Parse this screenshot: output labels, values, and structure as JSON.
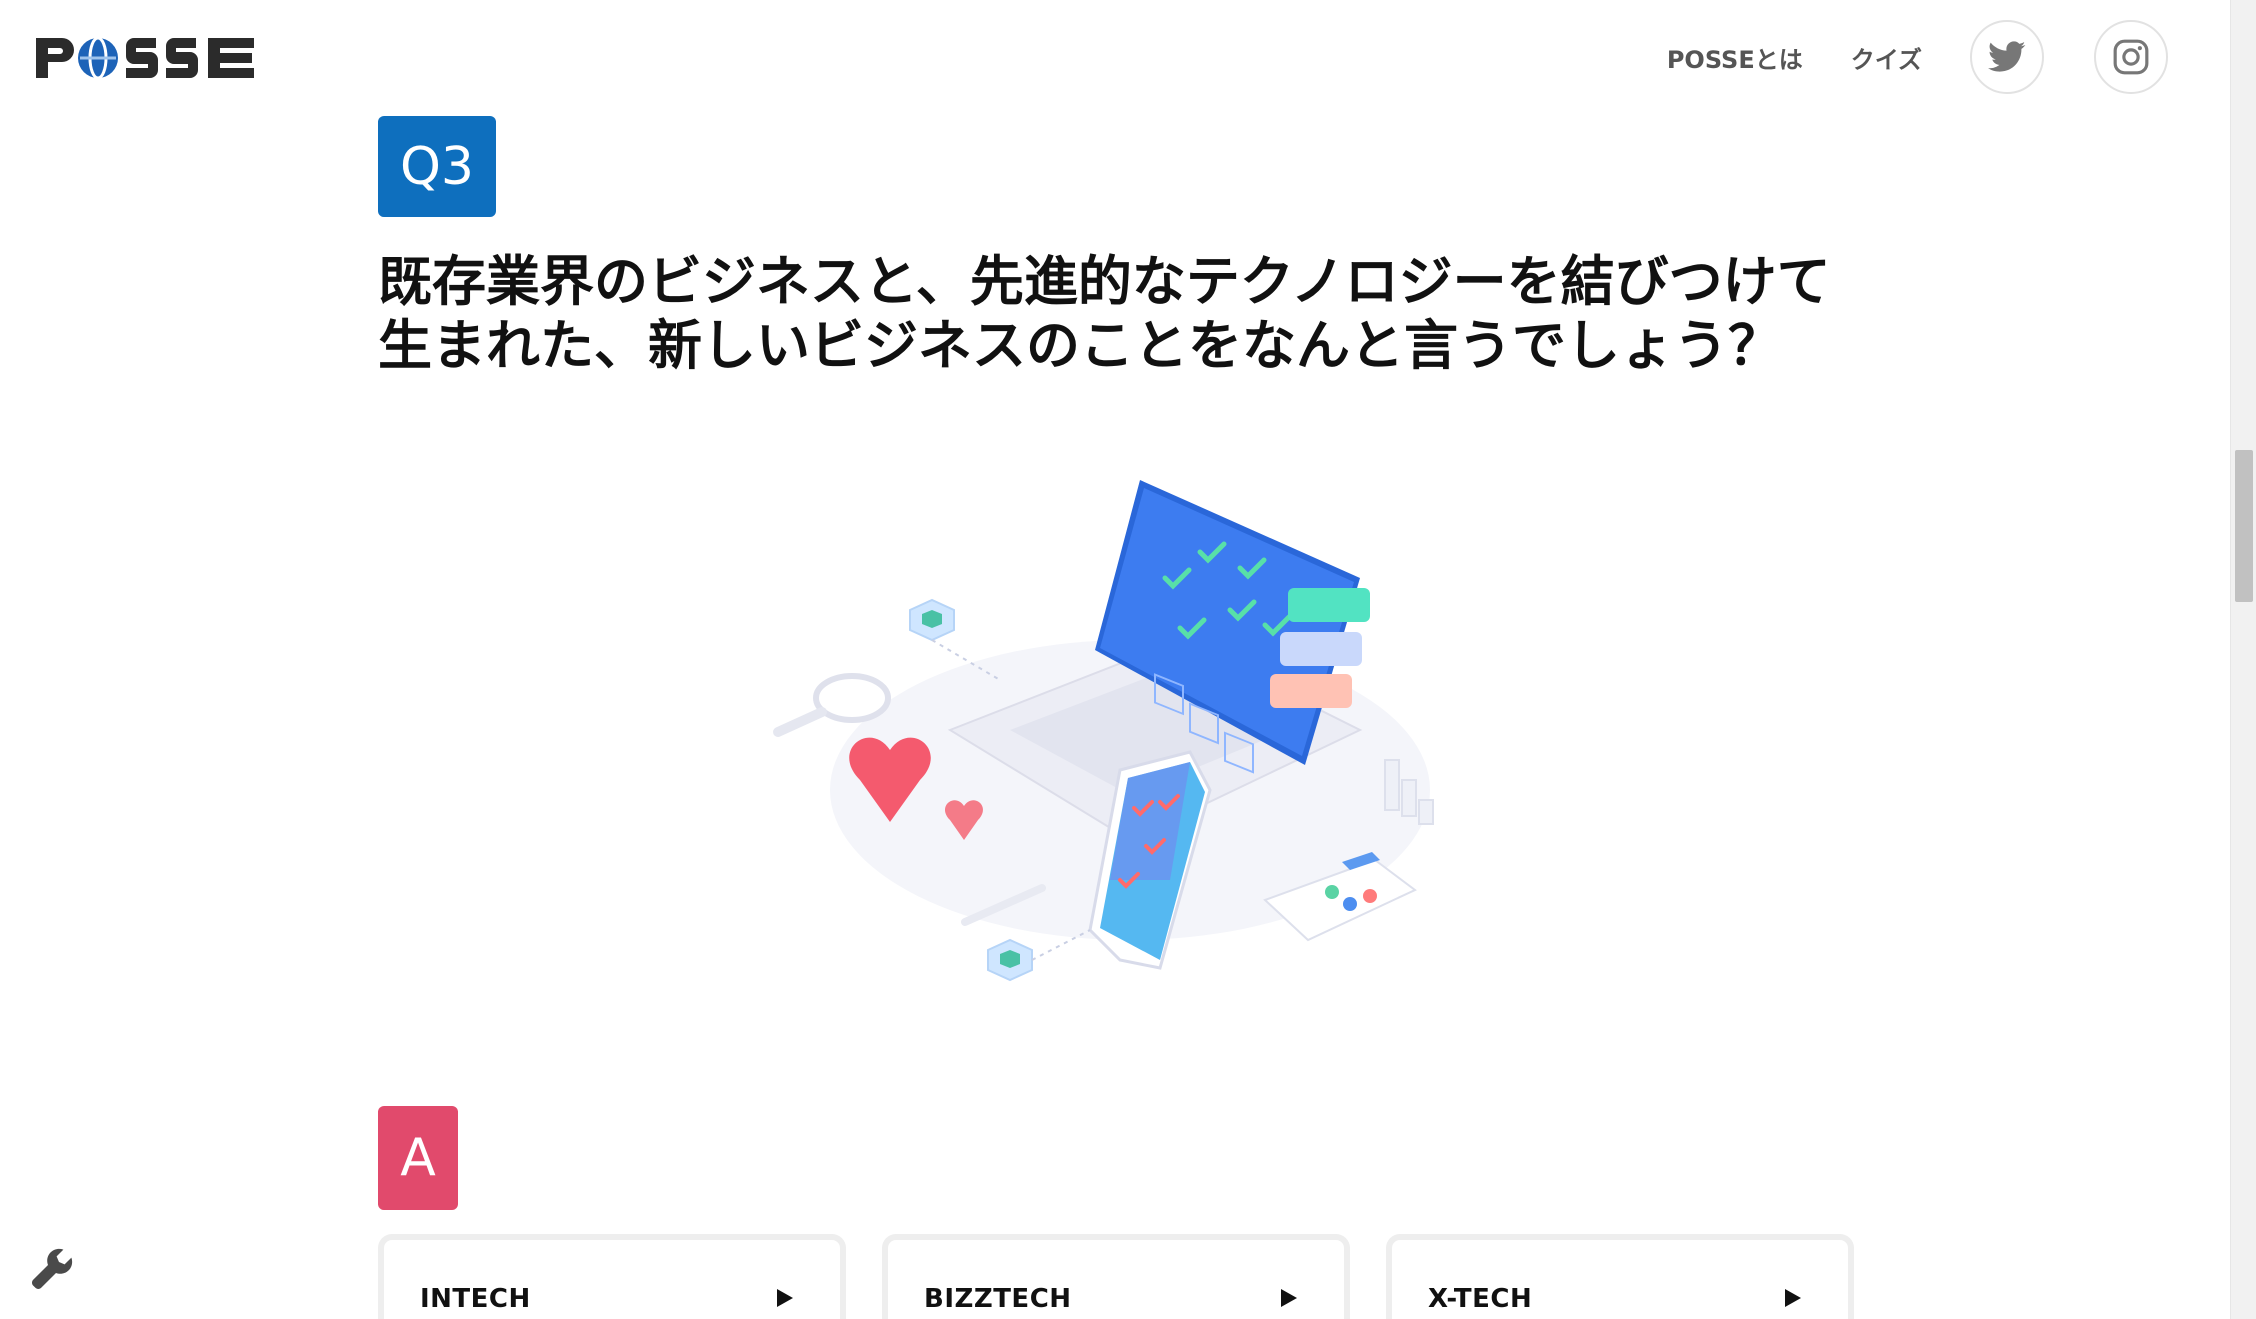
{
  "header": {
    "logo_text": "POSSE",
    "nav": [
      {
        "label": "POSSEとは"
      },
      {
        "label": "クイズ"
      }
    ],
    "social": [
      {
        "icon": "twitter-icon"
      },
      {
        "icon": "instagram-icon"
      }
    ]
  },
  "question": {
    "badge": "Q3",
    "text": "既存業界のビジネスと、先進的なテクノロジーを結びつけて\n生まれた、新しいビジネスのことをなんと言うでしょう？"
  },
  "answer": {
    "badge": "A",
    "options": [
      {
        "label": "INTECH"
      },
      {
        "label": "BIZZTECH"
      },
      {
        "label": "X-TECH"
      }
    ]
  },
  "colors": {
    "question_badge": "#0e6fbe",
    "answer_badge": "#e14a6c",
    "text": "#111111",
    "nav_text": "#555555"
  },
  "icons": [
    "twitter-icon",
    "instagram-icon",
    "play-arrow-icon",
    "wrench-icon",
    "tech-illustration"
  ]
}
